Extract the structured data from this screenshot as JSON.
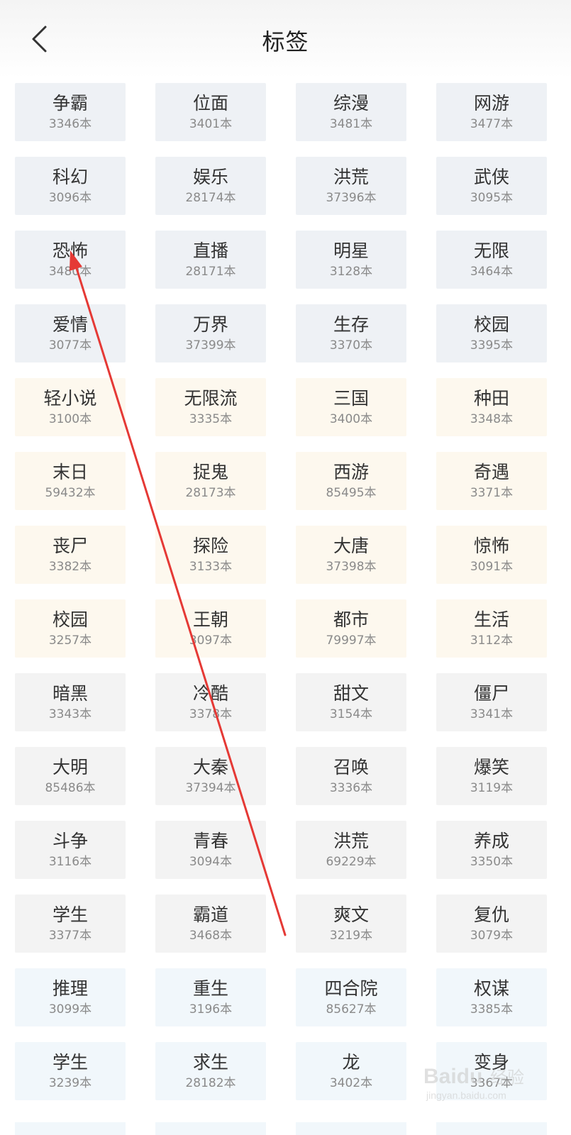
{
  "header": {
    "title": "标签",
    "back_icon": "chevron-left-icon"
  },
  "colors": {
    "tone_blue": "#eef1f5",
    "tone_cream": "#fdf8ee",
    "tone_gray": "#f3f3f3",
    "tone_sky": "#f1f7fb",
    "annotation_arrow": "#e53935"
  },
  "tags": [
    {
      "name": "争霸",
      "count": "3346本",
      "tone": "blue"
    },
    {
      "name": "位面",
      "count": "3401本",
      "tone": "blue"
    },
    {
      "name": "综漫",
      "count": "3481本",
      "tone": "blue"
    },
    {
      "name": "网游",
      "count": "3477本",
      "tone": "blue"
    },
    {
      "name": "科幻",
      "count": "3096本",
      "tone": "blue"
    },
    {
      "name": "娱乐",
      "count": "28174本",
      "tone": "blue"
    },
    {
      "name": "洪荒",
      "count": "37396本",
      "tone": "blue"
    },
    {
      "name": "武侠",
      "count": "3095本",
      "tone": "blue"
    },
    {
      "name": "恐怖",
      "count": "3480本",
      "tone": "blue"
    },
    {
      "name": "直播",
      "count": "28171本",
      "tone": "blue"
    },
    {
      "name": "明星",
      "count": "3128本",
      "tone": "blue"
    },
    {
      "name": "无限",
      "count": "3464本",
      "tone": "blue"
    },
    {
      "name": "爱情",
      "count": "3077本",
      "tone": "blue"
    },
    {
      "name": "万界",
      "count": "37399本",
      "tone": "blue"
    },
    {
      "name": "生存",
      "count": "3370本",
      "tone": "blue"
    },
    {
      "name": "校园",
      "count": "3395本",
      "tone": "blue"
    },
    {
      "name": "轻小说",
      "count": "3100本",
      "tone": "cream"
    },
    {
      "name": "无限流",
      "count": "3335本",
      "tone": "cream"
    },
    {
      "name": "三国",
      "count": "3400本",
      "tone": "cream"
    },
    {
      "name": "种田",
      "count": "3348本",
      "tone": "cream"
    },
    {
      "name": "末日",
      "count": "59432本",
      "tone": "cream"
    },
    {
      "name": "捉鬼",
      "count": "28173本",
      "tone": "cream"
    },
    {
      "name": "西游",
      "count": "85495本",
      "tone": "cream"
    },
    {
      "name": "奇遇",
      "count": "3371本",
      "tone": "cream"
    },
    {
      "name": "丧尸",
      "count": "3382本",
      "tone": "cream"
    },
    {
      "name": "探险",
      "count": "3133本",
      "tone": "cream"
    },
    {
      "name": "大唐",
      "count": "37398本",
      "tone": "cream"
    },
    {
      "name": "惊怖",
      "count": "3091本",
      "tone": "cream"
    },
    {
      "name": "校园",
      "count": "3257本",
      "tone": "cream"
    },
    {
      "name": "王朝",
      "count": "3097本",
      "tone": "cream"
    },
    {
      "name": "都市",
      "count": "79997本",
      "tone": "cream"
    },
    {
      "name": "生活",
      "count": "3112本",
      "tone": "cream"
    },
    {
      "name": "暗黑",
      "count": "3343本",
      "tone": "gray"
    },
    {
      "name": "冷酷",
      "count": "3378本",
      "tone": "gray"
    },
    {
      "name": "甜文",
      "count": "3154本",
      "tone": "gray"
    },
    {
      "name": "僵尸",
      "count": "3341本",
      "tone": "gray"
    },
    {
      "name": "大明",
      "count": "85486本",
      "tone": "gray"
    },
    {
      "name": "大秦",
      "count": "37394本",
      "tone": "gray"
    },
    {
      "name": "召唤",
      "count": "3336本",
      "tone": "gray"
    },
    {
      "name": "爆笑",
      "count": "3119本",
      "tone": "gray"
    },
    {
      "name": "斗争",
      "count": "3116本",
      "tone": "gray"
    },
    {
      "name": "青春",
      "count": "3094本",
      "tone": "gray"
    },
    {
      "name": "洪荒",
      "count": "69229本",
      "tone": "gray"
    },
    {
      "name": "养成",
      "count": "3350本",
      "tone": "gray"
    },
    {
      "name": "学生",
      "count": "3377本",
      "tone": "gray"
    },
    {
      "name": "霸道",
      "count": "3468本",
      "tone": "gray"
    },
    {
      "name": "爽文",
      "count": "3219本",
      "tone": "gray"
    },
    {
      "name": "复仇",
      "count": "3079本",
      "tone": "gray"
    },
    {
      "name": "推理",
      "count": "3099本",
      "tone": "sky"
    },
    {
      "name": "重生",
      "count": "3196本",
      "tone": "sky"
    },
    {
      "name": "四合院",
      "count": "85627本",
      "tone": "sky"
    },
    {
      "name": "权谋",
      "count": "3385本",
      "tone": "sky"
    },
    {
      "name": "学生",
      "count": "3239本",
      "tone": "sky"
    },
    {
      "name": "求生",
      "count": "28182本",
      "tone": "sky"
    },
    {
      "name": "龙",
      "count": "3402本",
      "tone": "sky"
    },
    {
      "name": "变身",
      "count": "3367本",
      "tone": "sky"
    }
  ],
  "watermark": {
    "brand": "Baidu",
    "suffix": "经验",
    "url": "jingyan.baidu.com"
  }
}
